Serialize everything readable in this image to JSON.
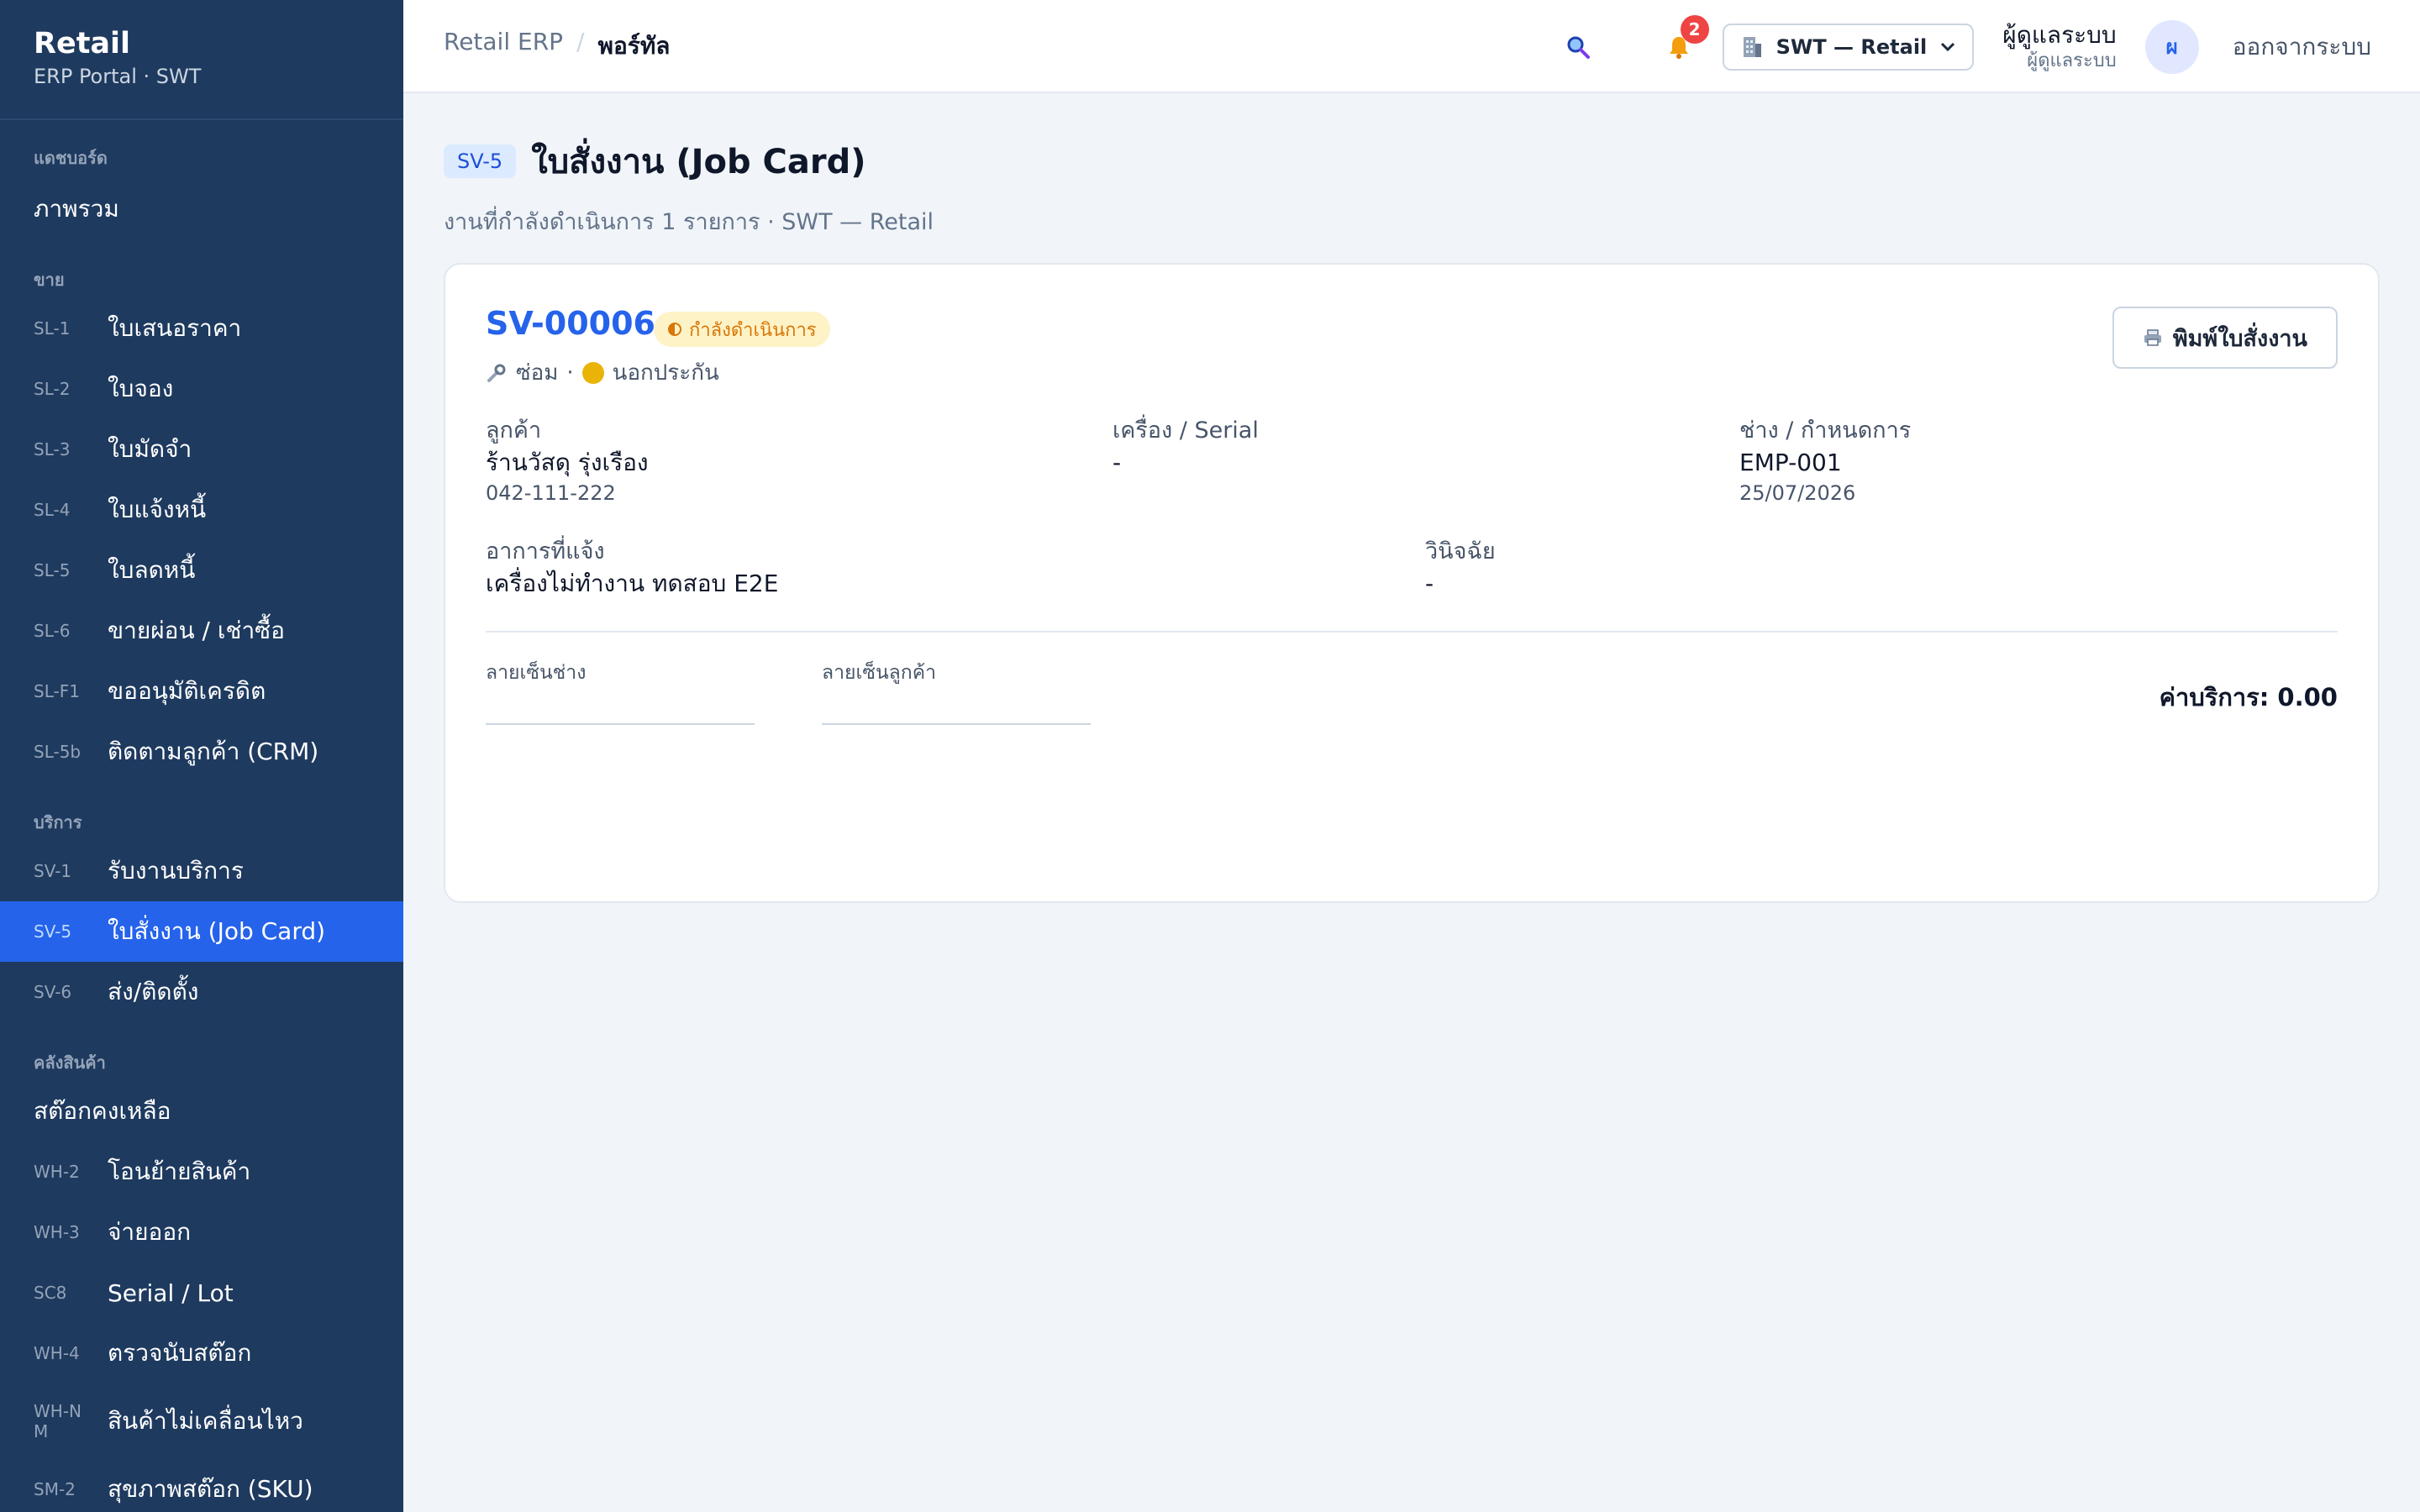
{
  "sidebar": {
    "brand_title": "Retail",
    "brand_sub": "ERP Portal · SWT",
    "sections": [
      {
        "title": "แดชบอร์ด",
        "items": [
          {
            "code": "",
            "label": "ภาพรวม"
          }
        ]
      },
      {
        "title": "ขาย",
        "items": [
          {
            "code": "SL-1",
            "label": "ใบเสนอราคา"
          },
          {
            "code": "SL-2",
            "label": "ใบจอง"
          },
          {
            "code": "SL-3",
            "label": "ใบมัดจำ"
          },
          {
            "code": "SL-4",
            "label": "ใบแจ้งหนี้"
          },
          {
            "code": "SL-5",
            "label": "ใบลดหนี้"
          },
          {
            "code": "SL-6",
            "label": "ขายผ่อน / เช่าซื้อ"
          },
          {
            "code": "SL-F1",
            "label": "ขออนุมัติเครดิต"
          },
          {
            "code": "SL-5b",
            "label": "ติดตามลูกค้า (CRM)"
          }
        ]
      },
      {
        "title": "บริการ",
        "items": [
          {
            "code": "SV-1",
            "label": "รับงานบริการ"
          },
          {
            "code": "SV-5",
            "label": "ใบสั่งงาน (Job Card)"
          },
          {
            "code": "SV-6",
            "label": "ส่ง/ติดตั้ง"
          }
        ]
      },
      {
        "title": "คลังสินค้า",
        "items": [
          {
            "code": "",
            "label": "สต๊อกคงเหลือ"
          },
          {
            "code": "WH-2",
            "label": "โอนย้ายสินค้า"
          },
          {
            "code": "WH-3",
            "label": "จ่ายออก"
          },
          {
            "code": "SC8",
            "label": "Serial / Lot"
          },
          {
            "code": "WH-4",
            "label": "ตรวจนับสต๊อก"
          },
          {
            "code": "WH-NM",
            "label": "สินค้าไม่เคลื่อนไหว"
          },
          {
            "code": "SM-2",
            "label": "สุขภาพสต๊อก (SKU)"
          }
        ]
      }
    ]
  },
  "header": {
    "breadcrumb_root": "Retail ERP",
    "breadcrumb_sep": "/",
    "breadcrumb_current": "พอร์ทัล",
    "notification_count": "2",
    "company_label": "SWT — Retail",
    "user_name": "ผู้ดูแลระบบ",
    "user_role": "ผู้ดูแลระบบ",
    "avatar_initial": "ผ",
    "logout_label": "ออกจากระบบ"
  },
  "page": {
    "code": "SV-5",
    "title": "ใบสั่งงาน (Job Card)",
    "subtitle": "งานที่กำลังดำเนินการ 1 รายการ · SWT — Retail"
  },
  "job": {
    "number": "SV-00006",
    "status": "กำลังดำเนินการ",
    "type": "ซ่อม",
    "meta_sep": "·",
    "warranty": "นอกประกัน",
    "print_label": "พิมพ์ใบสั่งงาน",
    "customer_label": "ลูกค้า",
    "customer_name": "ร้านวัสดุ รุ่งเรือง",
    "customer_phone": "042-111-222",
    "machine_label": "เครื่อง / Serial",
    "machine_value": "-",
    "tech_label": "ช่าง / กำหนดการ",
    "tech_value": "EMP-001",
    "tech_date": "25/07/2026",
    "symptom_label": "อาการที่แจ้ง",
    "symptom_value": "เครื่องไม่ทำงาน ทดสอบ E2E",
    "diagnosis_label": "วินิจฉัย",
    "diagnosis_value": "-",
    "sig_tech_label": "ลายเซ็นช่าง",
    "sig_customer_label": "ลายเซ็นลูกค้า",
    "fee_label": "ค่าบริการ: 0.00"
  },
  "icons": {
    "search": "search-icon",
    "bell": "bell-icon",
    "building": "building-icon",
    "chevron": "chevron-down-icon",
    "wrench": "wrench-icon",
    "coin": "coin-icon",
    "printer": "printer-icon",
    "status": "half-circle-icon"
  },
  "colors": {
    "sidebar_bg": "#1e3a5f",
    "active_bg": "#2563eb",
    "accent": "#2563eb",
    "status_bg": "#fef3c7",
    "status_fg": "#d97706",
    "badge": "#ef4444"
  }
}
